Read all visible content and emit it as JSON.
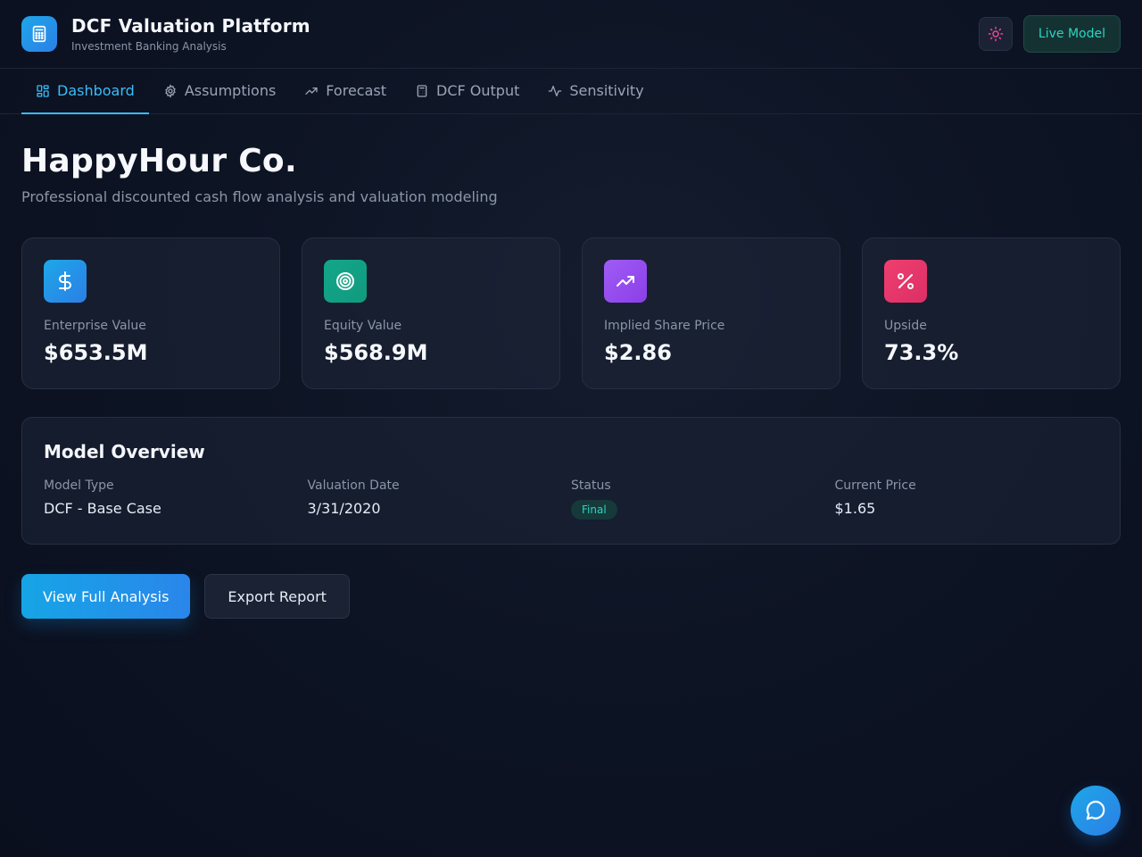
{
  "header": {
    "title": "DCF Valuation Platform",
    "subtitle": "Investment Banking Analysis",
    "logo_icon": "calculator-icon",
    "theme_icon": "sun-icon",
    "live_label": "Live Model"
  },
  "nav": {
    "tabs": [
      {
        "label": "Dashboard",
        "icon": "grid-icon",
        "active": true
      },
      {
        "label": "Assumptions",
        "icon": "gear-icon",
        "active": false
      },
      {
        "label": "Forecast",
        "icon": "trending-up-icon",
        "active": false
      },
      {
        "label": "DCF Output",
        "icon": "calculator-icon",
        "active": false
      },
      {
        "label": "Sensitivity",
        "icon": "activity-icon",
        "active": false
      }
    ]
  },
  "main": {
    "company": "HappyHour Co.",
    "tagline": "Professional discounted cash flow analysis and valuation modeling"
  },
  "metrics": [
    {
      "label": "Enterprise Value",
      "value": "$653.5M",
      "icon": "dollar-icon",
      "color": "#1f9de8"
    },
    {
      "label": "Equity Value",
      "value": "$568.9M",
      "icon": "target-icon",
      "color": "#14a68a"
    },
    {
      "label": "Implied Share Price",
      "value": "$2.86",
      "icon": "trending-up-icon",
      "color": "#9b4ff0"
    },
    {
      "label": "Upside",
      "value": "73.3%",
      "icon": "percent-icon",
      "color": "#e5396e"
    }
  ],
  "overview": {
    "title": "Model Overview",
    "model_type_label": "Model Type",
    "model_type": "DCF - Base Case",
    "valuation_date_label": "Valuation Date",
    "valuation_date": "3/31/2020",
    "status_label": "Status",
    "status": "Final",
    "current_price_label": "Current Price",
    "current_price": "$1.65"
  },
  "actions": {
    "primary": "View Full Analysis",
    "secondary": "Export Report"
  },
  "colors": {
    "accent": "#38bdf8",
    "live": "#2dd4bf",
    "background": "#0b1120"
  },
  "chat_icon": "chat-bubble-icon"
}
